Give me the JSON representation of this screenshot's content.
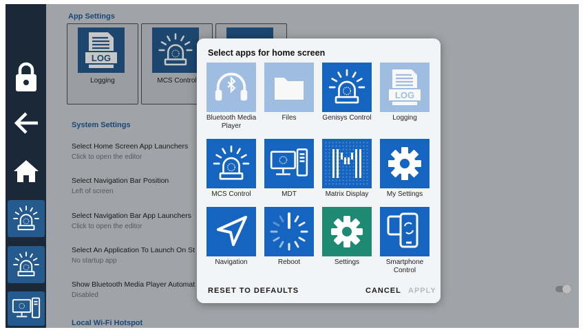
{
  "colors": {
    "tile_blue": "#1565c0",
    "tile_teal": "#1e8a72",
    "accent": "#1f5d9a",
    "nav_bg": "#1b2838"
  },
  "nav": {
    "items": [
      {
        "name": "lock-icon"
      },
      {
        "name": "back-arrow-icon"
      },
      {
        "name": "home-icon"
      },
      {
        "name": "mcs-control-icon"
      },
      {
        "name": "genisys-control-icon"
      },
      {
        "name": "mdt-icon"
      }
    ]
  },
  "background": {
    "app_settings_header": "App Settings",
    "app_cards": [
      {
        "label": "Logging",
        "icon": "log-icon"
      },
      {
        "label": "MCS Control",
        "icon": "siren-icon"
      },
      {
        "label": "",
        "icon": "mdt-icon"
      }
    ],
    "system_settings_header": "System Settings",
    "settings": [
      {
        "title": "Select Home Screen App Launchers",
        "sub": "Click to open the editor"
      },
      {
        "title": "Select Navigation Bar Position",
        "sub": "Left of screen"
      },
      {
        "title": "Select Navigation Bar App Launchers",
        "sub": "Click to open the editor"
      },
      {
        "title": "Select An Application To Launch On St",
        "sub": "No startup app"
      },
      {
        "title": "Show Bluetooth Media Player Automat",
        "sub": "Disabled"
      }
    ],
    "bluetooth_toggle_on": false,
    "hotspot_header": "Local Wi-Fi Hotspot"
  },
  "dialog": {
    "title": "Select apps for home screen",
    "apps": [
      {
        "label": "Bluetooth Media Player",
        "icon": "bluetooth-headphones-icon",
        "selected": false
      },
      {
        "label": "Files",
        "icon": "folder-icon",
        "selected": false
      },
      {
        "label": "Genisys Control",
        "icon": "siren-icon",
        "selected": true
      },
      {
        "label": "Logging",
        "icon": "log-icon",
        "selected": false
      },
      {
        "label": "MCS Control",
        "icon": "siren-icon",
        "selected": true
      },
      {
        "label": "MDT",
        "icon": "mdt-icon",
        "selected": true
      },
      {
        "label": "Matrix Display",
        "icon": "matrix-m-icon",
        "selected": true
      },
      {
        "label": "My Settings",
        "icon": "gear-icon",
        "selected": true
      },
      {
        "label": "Navigation",
        "icon": "navigation-arrow-icon",
        "selected": true
      },
      {
        "label": "Reboot",
        "icon": "reboot-icon",
        "selected": true
      },
      {
        "label": "Settings",
        "icon": "settings-gear-icon",
        "selected": true
      },
      {
        "label": "Smartphone Control",
        "icon": "smartphone-sync-icon",
        "selected": true
      }
    ],
    "reset_label": "RESET TO DEFAULTS",
    "cancel_label": "CANCEL",
    "apply_label": "APPLY"
  }
}
